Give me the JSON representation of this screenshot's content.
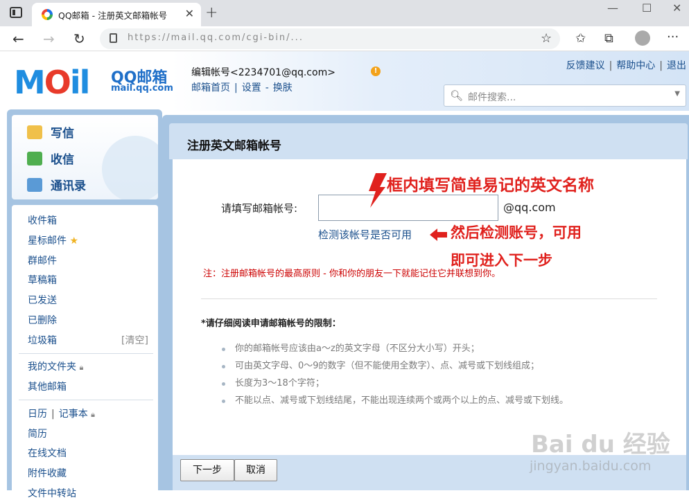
{
  "browser": {
    "tab_title": "QQ邮箱 - 注册英文邮箱帐号",
    "tab_close": "✕",
    "new_tab": "+",
    "minimize": "—",
    "maximize": "☐",
    "close": "✕",
    "back": "←",
    "forward": "→",
    "reload": "↻",
    "url": "https://mail.qq.com/cgi-bin/...",
    "more": "···"
  },
  "header": {
    "logo_mark": "MOil",
    "logo_cn": "QQ邮箱",
    "logo_domain": "mail.qq.com",
    "account": "编辑帐号<2234701@qq.com>",
    "warn": "!",
    "links": [
      "邮箱首页",
      "设置",
      "换肤"
    ],
    "top_links": [
      "反馈建议",
      "帮助中心",
      "退出"
    ],
    "search_placeholder": "邮件搜索..."
  },
  "sidebar": {
    "compose": "写信",
    "inbox_receive": "收信",
    "contacts": "通讯录",
    "folders": [
      "收件箱",
      "星标邮件",
      "群邮件",
      "草稿箱",
      "已发送",
      "已删除",
      "垃圾箱"
    ],
    "clear": "[清空]",
    "my_folders": "我的文件夹",
    "other_mail": "其他邮箱",
    "calendar": "日历",
    "notebook": "记事本",
    "resume": "简历",
    "online_docs": "在线文档",
    "attachments": "附件收藏",
    "file_transfer": "文件中转站"
  },
  "main": {
    "title": "注册英文邮箱帐号",
    "account_label": "请填写邮箱帐号:",
    "domain_suffix": "@qq.com",
    "check_link": "检测该帐号是否可用",
    "note": "注：注册邮箱帐号的最高原则 - 你和你的朋友一下就能记住它并联想到你。",
    "rules_title": "*请仔细阅读申请邮箱帐号的限制：",
    "rules": [
      "你的邮箱帐号应该由a～z的英文字母（不区分大小写）开头；",
      "可由英文字母、0～9的数字（但不能使用全数字）、点、减号或下划线组成；",
      "长度为3～18个字符；",
      "不能以点、减号或下划线结尾，不能出现连续两个或两个以上的点、减号或下划线。"
    ],
    "next_button": "下一步",
    "cancel_button": "取消"
  },
  "annotations": {
    "top": "框内填写简单易记的英文名称",
    "line1": "然后检测账号，可用",
    "line2": "即可进入下一步"
  },
  "watermark": {
    "brand": "Bai du 经验",
    "url": "jingyan.baidu.com"
  },
  "colors": {
    "link": "#1a4f8c",
    "panel_blue": "#a6c4e2",
    "annotation_red": "#e0211d",
    "note_red": "#c00000"
  }
}
